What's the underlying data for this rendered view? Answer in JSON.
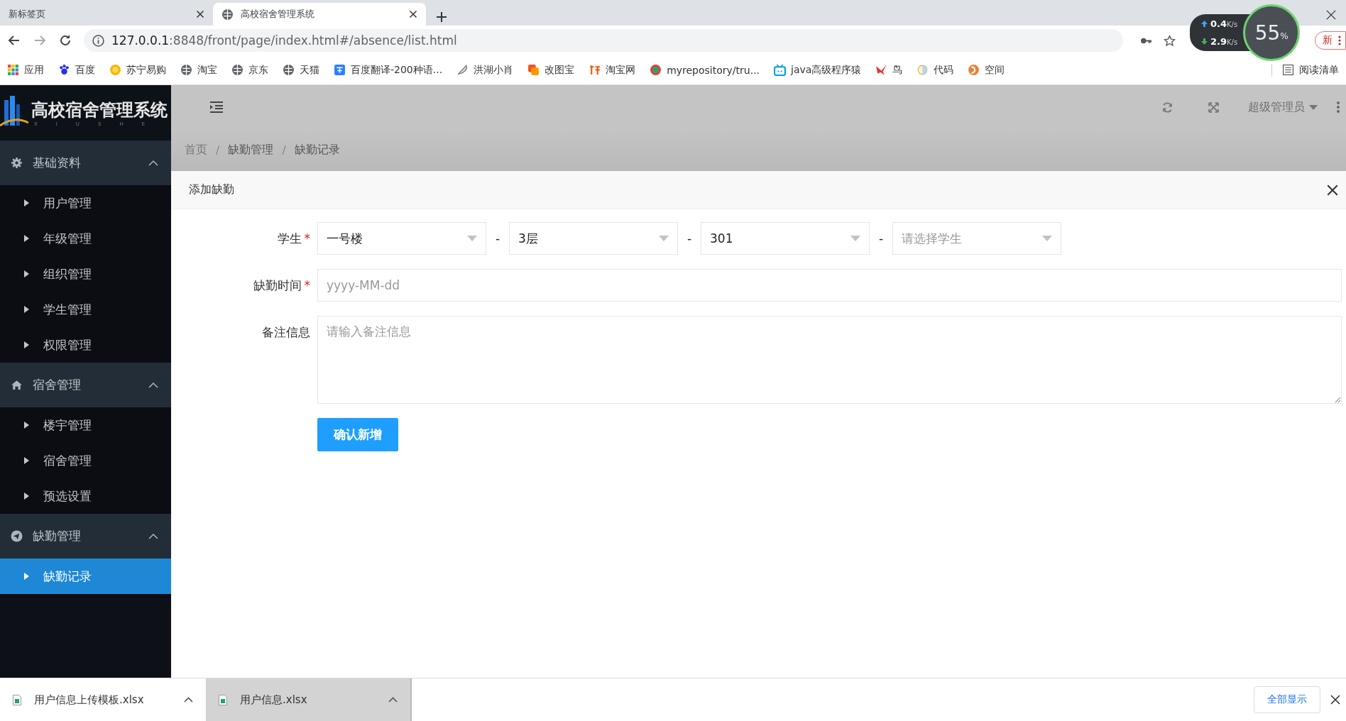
{
  "browser": {
    "tabs": [
      {
        "title": "新标签页",
        "selected": false
      },
      {
        "title": "高校宿舍管理系统",
        "selected": true
      }
    ],
    "address": {
      "host": "127.0.0.1",
      "path": ":8848/front/page/index.html#/absence/list.html"
    },
    "bookmarks": [
      {
        "label": "应用",
        "kind": "apps"
      },
      {
        "label": "百度",
        "kind": "paw"
      },
      {
        "label": "苏宁易购",
        "kind": "lion"
      },
      {
        "label": "淘宝",
        "kind": "globe"
      },
      {
        "label": "京东",
        "kind": "globe"
      },
      {
        "label": "天猫",
        "kind": "globe"
      },
      {
        "label": "百度翻译-200种语...",
        "kind": "translate"
      },
      {
        "label": "洪湖小肖",
        "kind": "feather"
      },
      {
        "label": "改图宝",
        "kind": "squares"
      },
      {
        "label": "淘宝网",
        "kind": "tao"
      },
      {
        "label": "myrepository/tru...",
        "kind": "ring"
      },
      {
        "label": "java高级程序猿",
        "kind": "tv"
      },
      {
        "label": "鸟",
        "kind": "bird"
      },
      {
        "label": "代码",
        "kind": "moon"
      },
      {
        "label": "空间",
        "kind": "swirl"
      }
    ],
    "reading_list": "阅读清单",
    "update_button": "新"
  },
  "net_widget": {
    "up": {
      "value": "0.4",
      "unit": "K/s"
    },
    "down": {
      "value": "2.9",
      "unit": "K/s"
    },
    "load": "55",
    "load_unit": "%"
  },
  "app": {
    "logo": {
      "title": "高校宿舍管理系统",
      "subtitle": "XIUSHE"
    },
    "sidebar": [
      {
        "label": "基础资料",
        "kind": "gear",
        "expanded": true,
        "children": [
          {
            "label": "用户管理",
            "selected": false
          },
          {
            "label": "年级管理",
            "selected": false
          },
          {
            "label": "组织管理",
            "selected": false
          },
          {
            "label": "学生管理",
            "selected": false
          },
          {
            "label": "权限管理",
            "selected": false
          }
        ]
      },
      {
        "label": "宿舍管理",
        "kind": "home",
        "expanded": true,
        "children": [
          {
            "label": "楼宇管理",
            "selected": false
          },
          {
            "label": "宿舍管理",
            "selected": false
          },
          {
            "label": "预选设置",
            "selected": false
          }
        ]
      },
      {
        "label": "缺勤管理",
        "kind": "send",
        "expanded": true,
        "children": [
          {
            "label": "缺勤记录",
            "selected": true
          }
        ]
      }
    ],
    "header": {
      "user": "超级管理员"
    },
    "breadcrumb": {
      "items": [
        "首页",
        "缺勤管理",
        "缺勤记录"
      ],
      "separators": [
        "/",
        "/"
      ]
    },
    "modal": {
      "title": "添加缺勤",
      "form": {
        "required_mark": "*",
        "student": {
          "label": "学生",
          "required": true,
          "selects": [
            {
              "value": "一号楼"
            },
            {
              "value": "3层"
            },
            {
              "value": "301"
            },
            {
              "placeholder": "请选择学生"
            }
          ],
          "separators": [
            "-",
            "-",
            "-"
          ]
        },
        "date": {
          "label": "缺勤时间",
          "required": true,
          "placeholder": "yyyy-MM-dd"
        },
        "remark": {
          "label": "备注信息",
          "required": false,
          "placeholder": "请输入备注信息"
        },
        "submit": "确认新增"
      }
    }
  },
  "downloads": {
    "files": [
      {
        "name": "用户信息上传模板.xlsx",
        "selected": false
      },
      {
        "name": "用户信息.xlsx",
        "selected": true
      }
    ],
    "show_all": "全部显示"
  }
}
